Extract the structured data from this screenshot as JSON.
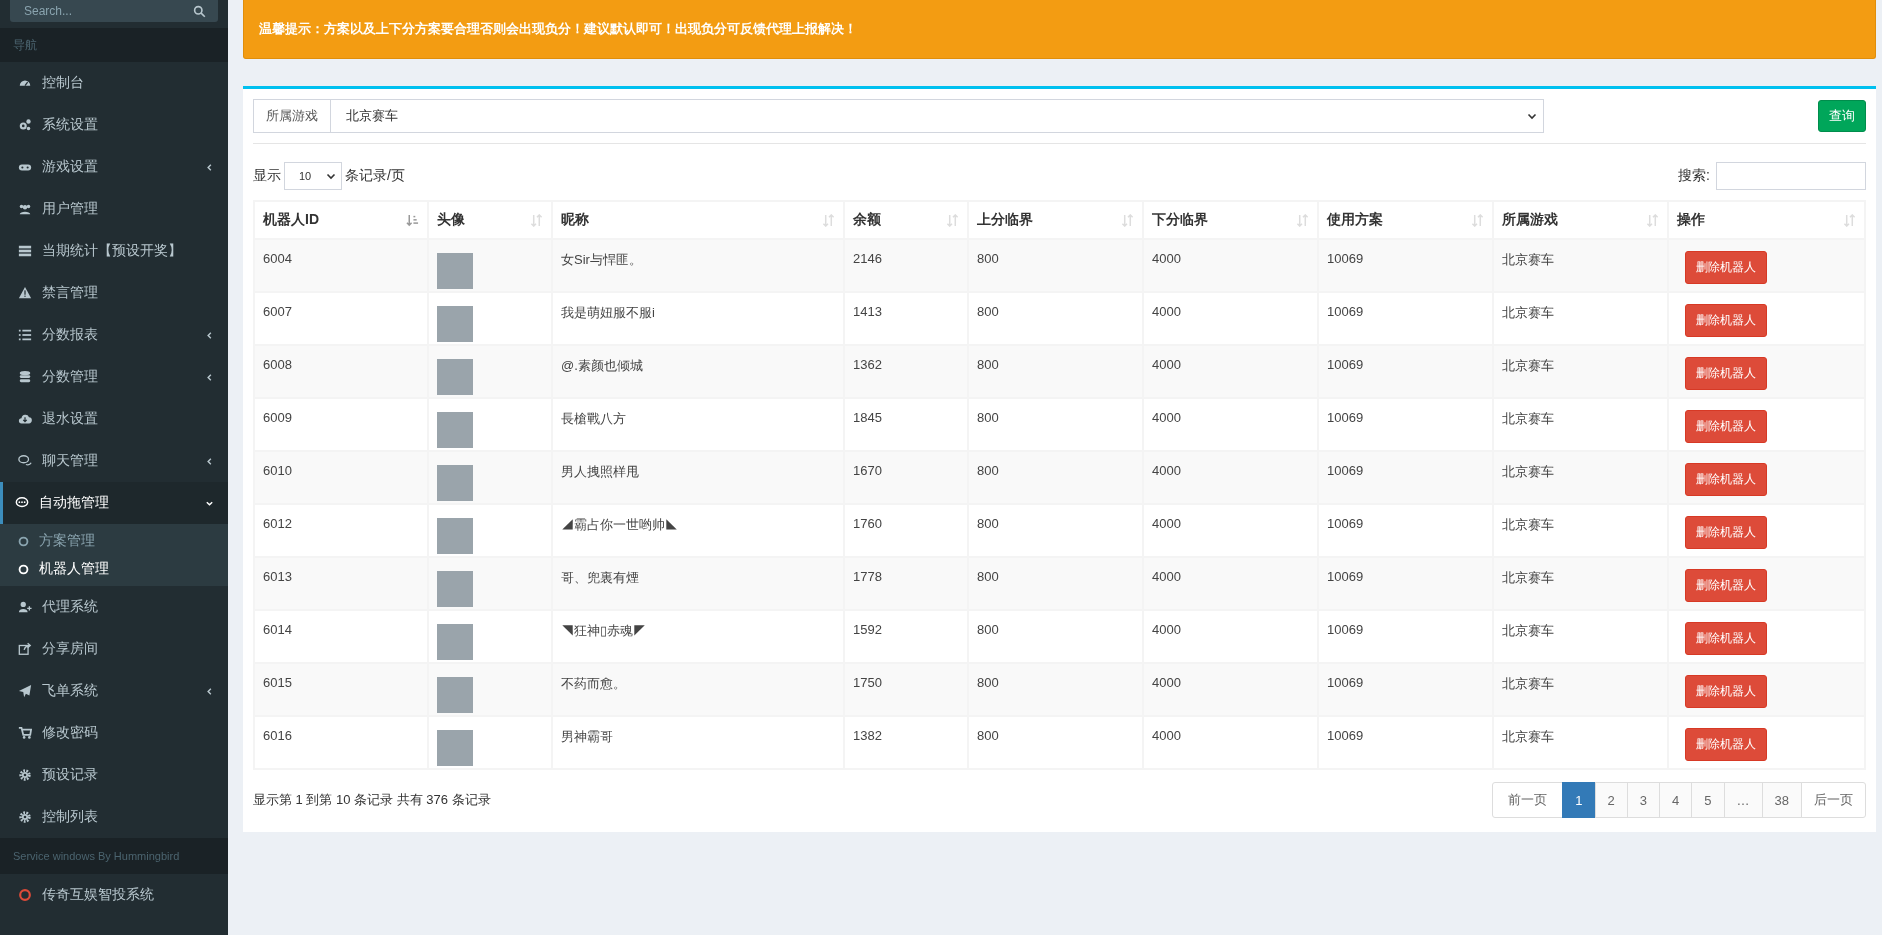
{
  "sidebar": {
    "search": {
      "placeholder": "Search..."
    },
    "header": "导航",
    "items": [
      {
        "label": "控制台",
        "selected": false
      },
      {
        "label": "系统设置",
        "selected": false
      },
      {
        "label": "游戏设置",
        "selected": false,
        "expanded": false
      },
      {
        "label": "用户管理",
        "selected": false
      },
      {
        "label": "当期统计【预设开奖】",
        "selected": false
      },
      {
        "label": "禁言管理",
        "selected": false
      },
      {
        "label": "分数报表",
        "selected": false,
        "expanded": false
      },
      {
        "label": "分数管理",
        "selected": false,
        "expanded": false
      },
      {
        "label": "退水设置",
        "selected": false
      },
      {
        "label": "聊天管理",
        "selected": false,
        "expanded": false
      },
      {
        "label": "自动拖管理",
        "selected": true,
        "expanded": true,
        "children": [
          {
            "label": "方案管理",
            "selected": false
          },
          {
            "label": "机器人管理",
            "selected": true
          }
        ]
      },
      {
        "label": "代理系统",
        "selected": false
      },
      {
        "label": "分享房间",
        "selected": false
      },
      {
        "label": "飞单系统",
        "selected": false,
        "expanded": false
      },
      {
        "label": "修改密码",
        "selected": false
      },
      {
        "label": "预设记录",
        "selected": false
      },
      {
        "label": "控制列表",
        "selected": false
      }
    ],
    "footer": "Service windows By Hummingbird",
    "bottom_item": "传奇互娱智投系统"
  },
  "alert": "温馨提示：方案以及上下分方案要合理否则会出现负分！建议默认即可！出现负分可反馈代理上报解决！",
  "filter": {
    "label": "所属游戏",
    "value": "北京赛车",
    "button": "查询"
  },
  "length": {
    "before": "显示",
    "value": "10",
    "after": "条记录/页"
  },
  "search": {
    "label": "搜索:"
  },
  "table": {
    "columns": [
      {
        "label": "机器人ID",
        "sorted": true
      },
      {
        "label": "头像",
        "sorted": false
      },
      {
        "label": "昵称",
        "sorted": false
      },
      {
        "label": "余额",
        "sorted": false
      },
      {
        "label": "上分临界",
        "sorted": false
      },
      {
        "label": "下分临界",
        "sorted": false
      },
      {
        "label": "使用方案",
        "sorted": false
      },
      {
        "label": "所属游戏",
        "sorted": false
      },
      {
        "label": "操作",
        "sorted": false
      }
    ],
    "rows": [
      {
        "id": "6004",
        "nickname": "女Sir与悍匪。",
        "balance": "2146",
        "up": "800",
        "down": "4000",
        "plan": "10069",
        "game": "北京赛车",
        "action": "删除机器人"
      },
      {
        "id": "6007",
        "nickname": "我是萌妞服不服i",
        "balance": "1413",
        "up": "800",
        "down": "4000",
        "plan": "10069",
        "game": "北京赛车",
        "action": "删除机器人"
      },
      {
        "id": "6008",
        "nickname": "@.素颜也倾城",
        "balance": "1362",
        "up": "800",
        "down": "4000",
        "plan": "10069",
        "game": "北京赛车",
        "action": "删除机器人"
      },
      {
        "id": "6009",
        "nickname": "長槍戰八方",
        "balance": "1845",
        "up": "800",
        "down": "4000",
        "plan": "10069",
        "game": "北京赛车",
        "action": "删除机器人"
      },
      {
        "id": "6010",
        "nickname": "男人拽照样甩",
        "balance": "1670",
        "up": "800",
        "down": "4000",
        "plan": "10069",
        "game": "北京赛车",
        "action": "删除机器人"
      },
      {
        "id": "6012",
        "nickname": "◢霸占你一世哟帅◣",
        "balance": "1760",
        "up": "800",
        "down": "4000",
        "plan": "10069",
        "game": "北京赛车",
        "action": "删除机器人"
      },
      {
        "id": "6013",
        "nickname": "哥、兜裏有煙",
        "balance": "1778",
        "up": "800",
        "down": "4000",
        "plan": "10069",
        "game": "北京赛车",
        "action": "删除机器人"
      },
      {
        "id": "6014",
        "nickname": "◥狂神▯赤魂◤",
        "balance": "1592",
        "up": "800",
        "down": "4000",
        "plan": "10069",
        "game": "北京赛车",
        "action": "删除机器人"
      },
      {
        "id": "6015",
        "nickname": "不药而愈。",
        "balance": "1750",
        "up": "800",
        "down": "4000",
        "plan": "10069",
        "game": "北京赛车",
        "action": "删除机器人"
      },
      {
        "id": "6016",
        "nickname": "男神霸哥",
        "balance": "1382",
        "up": "800",
        "down": "4000",
        "plan": "10069",
        "game": "北京赛车",
        "action": "删除机器人"
      }
    ]
  },
  "info": "显示第 1 到第 10 条记录 共有 376 条记录",
  "pagination": {
    "previous": "前一页",
    "next": "后一页",
    "pages": [
      {
        "label": "1",
        "selected": true
      },
      {
        "label": "2",
        "selected": false
      },
      {
        "label": "3",
        "selected": false
      },
      {
        "label": "4",
        "selected": false
      },
      {
        "label": "5",
        "selected": false
      },
      {
        "label": "…",
        "selected": false
      },
      {
        "label": "38",
        "selected": false
      }
    ]
  }
}
